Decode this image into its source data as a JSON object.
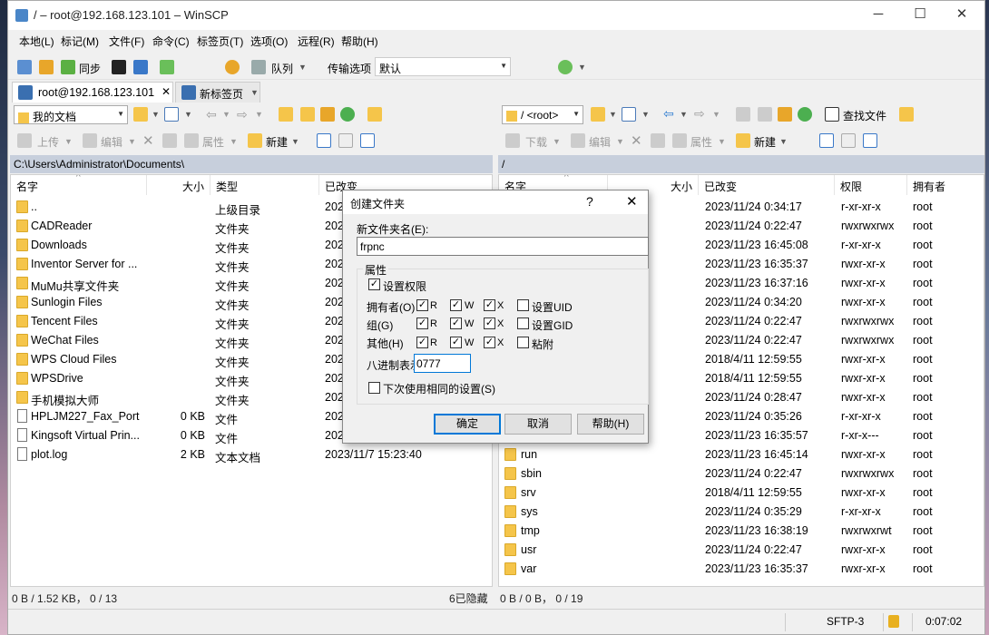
{
  "window": {
    "title": "/ – root@192.168.123.101 – WinSCP"
  },
  "menu": [
    "本地(L)",
    "标记(M)",
    "文件(F)",
    "命令(C)",
    "标签页(T)",
    "选项(O)",
    "远程(R)",
    "帮助(H)"
  ],
  "toolbar": {
    "sync": "同步",
    "queue": "队列",
    "transfer_label": "传输选项",
    "transfer_value": "默认"
  },
  "tabs": {
    "session": "root@192.168.123.101",
    "new_tab": "新标签页"
  },
  "left": {
    "location": "我的文档",
    "actions": {
      "upload": "上传",
      "edit": "编辑",
      "properties": "属性",
      "new": "新建"
    },
    "path": "C:\\Users\\Administrator\\Documents\\",
    "headers": {
      "name": "名字",
      "size": "大小",
      "type": "类型",
      "changed": "已改变"
    },
    "rows": [
      {
        "name": "..",
        "size": "",
        "type": "上级目录",
        "changed": "202"
      },
      {
        "name": "CADReader",
        "size": "",
        "type": "文件夹",
        "changed": "202"
      },
      {
        "name": "Downloads",
        "size": "",
        "type": "文件夹",
        "changed": "202"
      },
      {
        "name": "Inventor Server for ...",
        "size": "",
        "type": "文件夹",
        "changed": "202"
      },
      {
        "name": "MuMu共享文件夹",
        "size": "",
        "type": "文件夹",
        "changed": "202"
      },
      {
        "name": "Sunlogin Files",
        "size": "",
        "type": "文件夹",
        "changed": "202"
      },
      {
        "name": "Tencent Files",
        "size": "",
        "type": "文件夹",
        "changed": "202"
      },
      {
        "name": "WeChat Files",
        "size": "",
        "type": "文件夹",
        "changed": "202"
      },
      {
        "name": "WPS Cloud Files",
        "size": "",
        "type": "文件夹",
        "changed": "202"
      },
      {
        "name": "WPSDrive",
        "size": "",
        "type": "文件夹",
        "changed": "202"
      },
      {
        "name": "手机模拟大师",
        "size": "",
        "type": "文件夹",
        "changed": "202"
      },
      {
        "name": "HPLJM227_Fax_Port",
        "size": "0 KB",
        "type": "文件",
        "changed": "202"
      },
      {
        "name": "Kingsoft Virtual Prin...",
        "size": "0 KB",
        "type": "文件",
        "changed": "202"
      },
      {
        "name": "plot.log",
        "size": "2 KB",
        "type": "文本文档",
        "changed": "2023/11/7 15:23:40"
      }
    ],
    "status": "0 B / 1.52 KB， 0 / 13",
    "hidden": "6已隐藏"
  },
  "right": {
    "location": "/ <root>",
    "find": "查找文件",
    "actions": {
      "download": "下载",
      "edit": "编辑",
      "properties": "属性",
      "new": "新建"
    },
    "path": "/",
    "headers": {
      "name": "名字",
      "size": "大小",
      "changed": "已改变",
      "rights": "权限",
      "owner": "拥有者"
    },
    "rows": [
      {
        "name": "",
        "changed": "2023/11/24 0:34:17",
        "rights": "r-xr-xr-x",
        "owner": "root"
      },
      {
        "name": "",
        "changed": "2023/11/24 0:22:47",
        "rights": "rwxrwxrwx",
        "owner": "root"
      },
      {
        "name": "",
        "changed": "2023/11/23 16:45:08",
        "rights": "r-xr-xr-x",
        "owner": "root"
      },
      {
        "name": "",
        "changed": "2023/11/23 16:35:37",
        "rights": "rwxr-xr-x",
        "owner": "root"
      },
      {
        "name": "",
        "changed": "2023/11/23 16:37:16",
        "rights": "rwxr-xr-x",
        "owner": "root"
      },
      {
        "name": "",
        "changed": "2023/11/24 0:34:20",
        "rights": "rwxr-xr-x",
        "owner": "root"
      },
      {
        "name": "",
        "changed": "2023/11/24 0:22:47",
        "rights": "rwxrwxrwx",
        "owner": "root"
      },
      {
        "name": "",
        "changed": "2023/11/24 0:22:47",
        "rights": "rwxrwxrwx",
        "owner": "root"
      },
      {
        "name": "",
        "changed": "2018/4/11 12:59:55",
        "rights": "rwxr-xr-x",
        "owner": "root"
      },
      {
        "name": "",
        "changed": "2018/4/11 12:59:55",
        "rights": "rwxr-xr-x",
        "owner": "root"
      },
      {
        "name": "",
        "changed": "2023/11/24 0:28:47",
        "rights": "rwxr-xr-x",
        "owner": "root"
      },
      {
        "name": "",
        "changed": "2023/11/24 0:35:26",
        "rights": "r-xr-xr-x",
        "owner": "root"
      },
      {
        "name": "",
        "changed": "2023/11/23 16:35:57",
        "rights": "r-xr-x---",
        "owner": "root"
      },
      {
        "name": "run",
        "changed": "2023/11/23 16:45:14",
        "rights": "rwxr-xr-x",
        "owner": "root"
      },
      {
        "name": "sbin",
        "changed": "2023/11/24 0:22:47",
        "rights": "rwxrwxrwx",
        "owner": "root"
      },
      {
        "name": "srv",
        "changed": "2018/4/11 12:59:55",
        "rights": "rwxr-xr-x",
        "owner": "root"
      },
      {
        "name": "sys",
        "changed": "2023/11/24 0:35:29",
        "rights": "r-xr-xr-x",
        "owner": "root"
      },
      {
        "name": "tmp",
        "changed": "2023/11/23 16:38:19",
        "rights": "rwxrwxrwt",
        "owner": "root"
      },
      {
        "name": "usr",
        "changed": "2023/11/24 0:22:47",
        "rights": "rwxr-xr-x",
        "owner": "root"
      },
      {
        "name": "var",
        "changed": "2023/11/23 16:35:37",
        "rights": "rwxr-xr-x",
        "owner": "root"
      }
    ],
    "status": "0 B / 0 B， 0 / 19"
  },
  "statusbar": {
    "protocol": "SFTP-3",
    "time": "0:07:02"
  },
  "dialog": {
    "title": "创建文件夹",
    "help_glyph": "?",
    "folder_label": "新文件夹名(E):",
    "folder_value": "frpnc",
    "attrs_group": "属性",
    "set_rights": "设置权限",
    "owner": "拥有者(O)",
    "group": "组(G)",
    "others": "其他(H)",
    "r": "R",
    "w": "W",
    "x": "X",
    "setuid": "设置UID",
    "setgid": "设置GID",
    "sticky": "粘附",
    "octal_label": "八进制表示",
    "octal_value": "0777",
    "use_same": "下次使用相同的设置(S)",
    "ok": "确定",
    "cancel": "取消",
    "help": "帮助(H)"
  }
}
